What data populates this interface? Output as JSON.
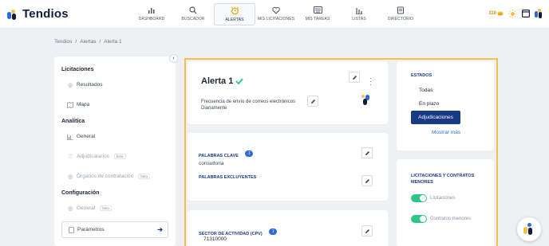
{
  "brand": {
    "name": "Tendios"
  },
  "nav": [
    {
      "label": "DASHBOARD",
      "icon": "bar-chart-icon"
    },
    {
      "label": "BUSCADOR",
      "icon": "search-icon"
    },
    {
      "label": "ALERTAS",
      "icon": "alarm-clock-icon",
      "active": true
    },
    {
      "label": "MIS LICITACIONES",
      "icon": "heart-icon"
    },
    {
      "label": "MIS TAREAS",
      "icon": "keyboard-icon"
    },
    {
      "label": "LISTAS",
      "icon": "list-icon"
    },
    {
      "label": "DIRECTORIO",
      "icon": "directory-icon"
    }
  ],
  "header_right": {
    "coins": "110"
  },
  "breadcrumb": [
    "Tendios",
    "/",
    "Alertas",
    "/",
    "Alerta 1"
  ],
  "sidebar": {
    "section_licitaciones": "Licitaciones",
    "resultados": "Resultados",
    "mapa": "Mapa",
    "section_analitica": "Analítica",
    "general": "General",
    "adjudicatarios": "Adjudicatarios",
    "organos": "Órganos de contratación",
    "beta": "beta",
    "section_configuracion": "Configuración",
    "config_general": "General",
    "parametros": "Parámetros"
  },
  "alert": {
    "title": "Alerta 1",
    "frequency_label": "Frecuencia de envío de correos electrónicos",
    "frequency_value": "Diariamente"
  },
  "keywords": {
    "label": "PALABRAS CLAVE",
    "count": "1",
    "value": "consultoria",
    "excluded_label": "PALABRAS EXCLUYENTES"
  },
  "sector": {
    "label": "SECTOR DE ACTIVIDAD (CPV)",
    "count": "1",
    "code": "71310000"
  },
  "estados": {
    "title": "ESTADOS",
    "options": [
      "Todas",
      "En plazo",
      "Adjudicaciones"
    ],
    "selected": "Adjudicaciones",
    "more": "Mostrar más"
  },
  "menores": {
    "title": "LICITACIONES Y CONTRATOS MENORES",
    "licitaciones": "Licitaciones",
    "contratos": "Contratos menores"
  },
  "colors": {
    "accent": "#173a84",
    "highlight": "#f2c14c",
    "toggle": "#2ec48a"
  }
}
